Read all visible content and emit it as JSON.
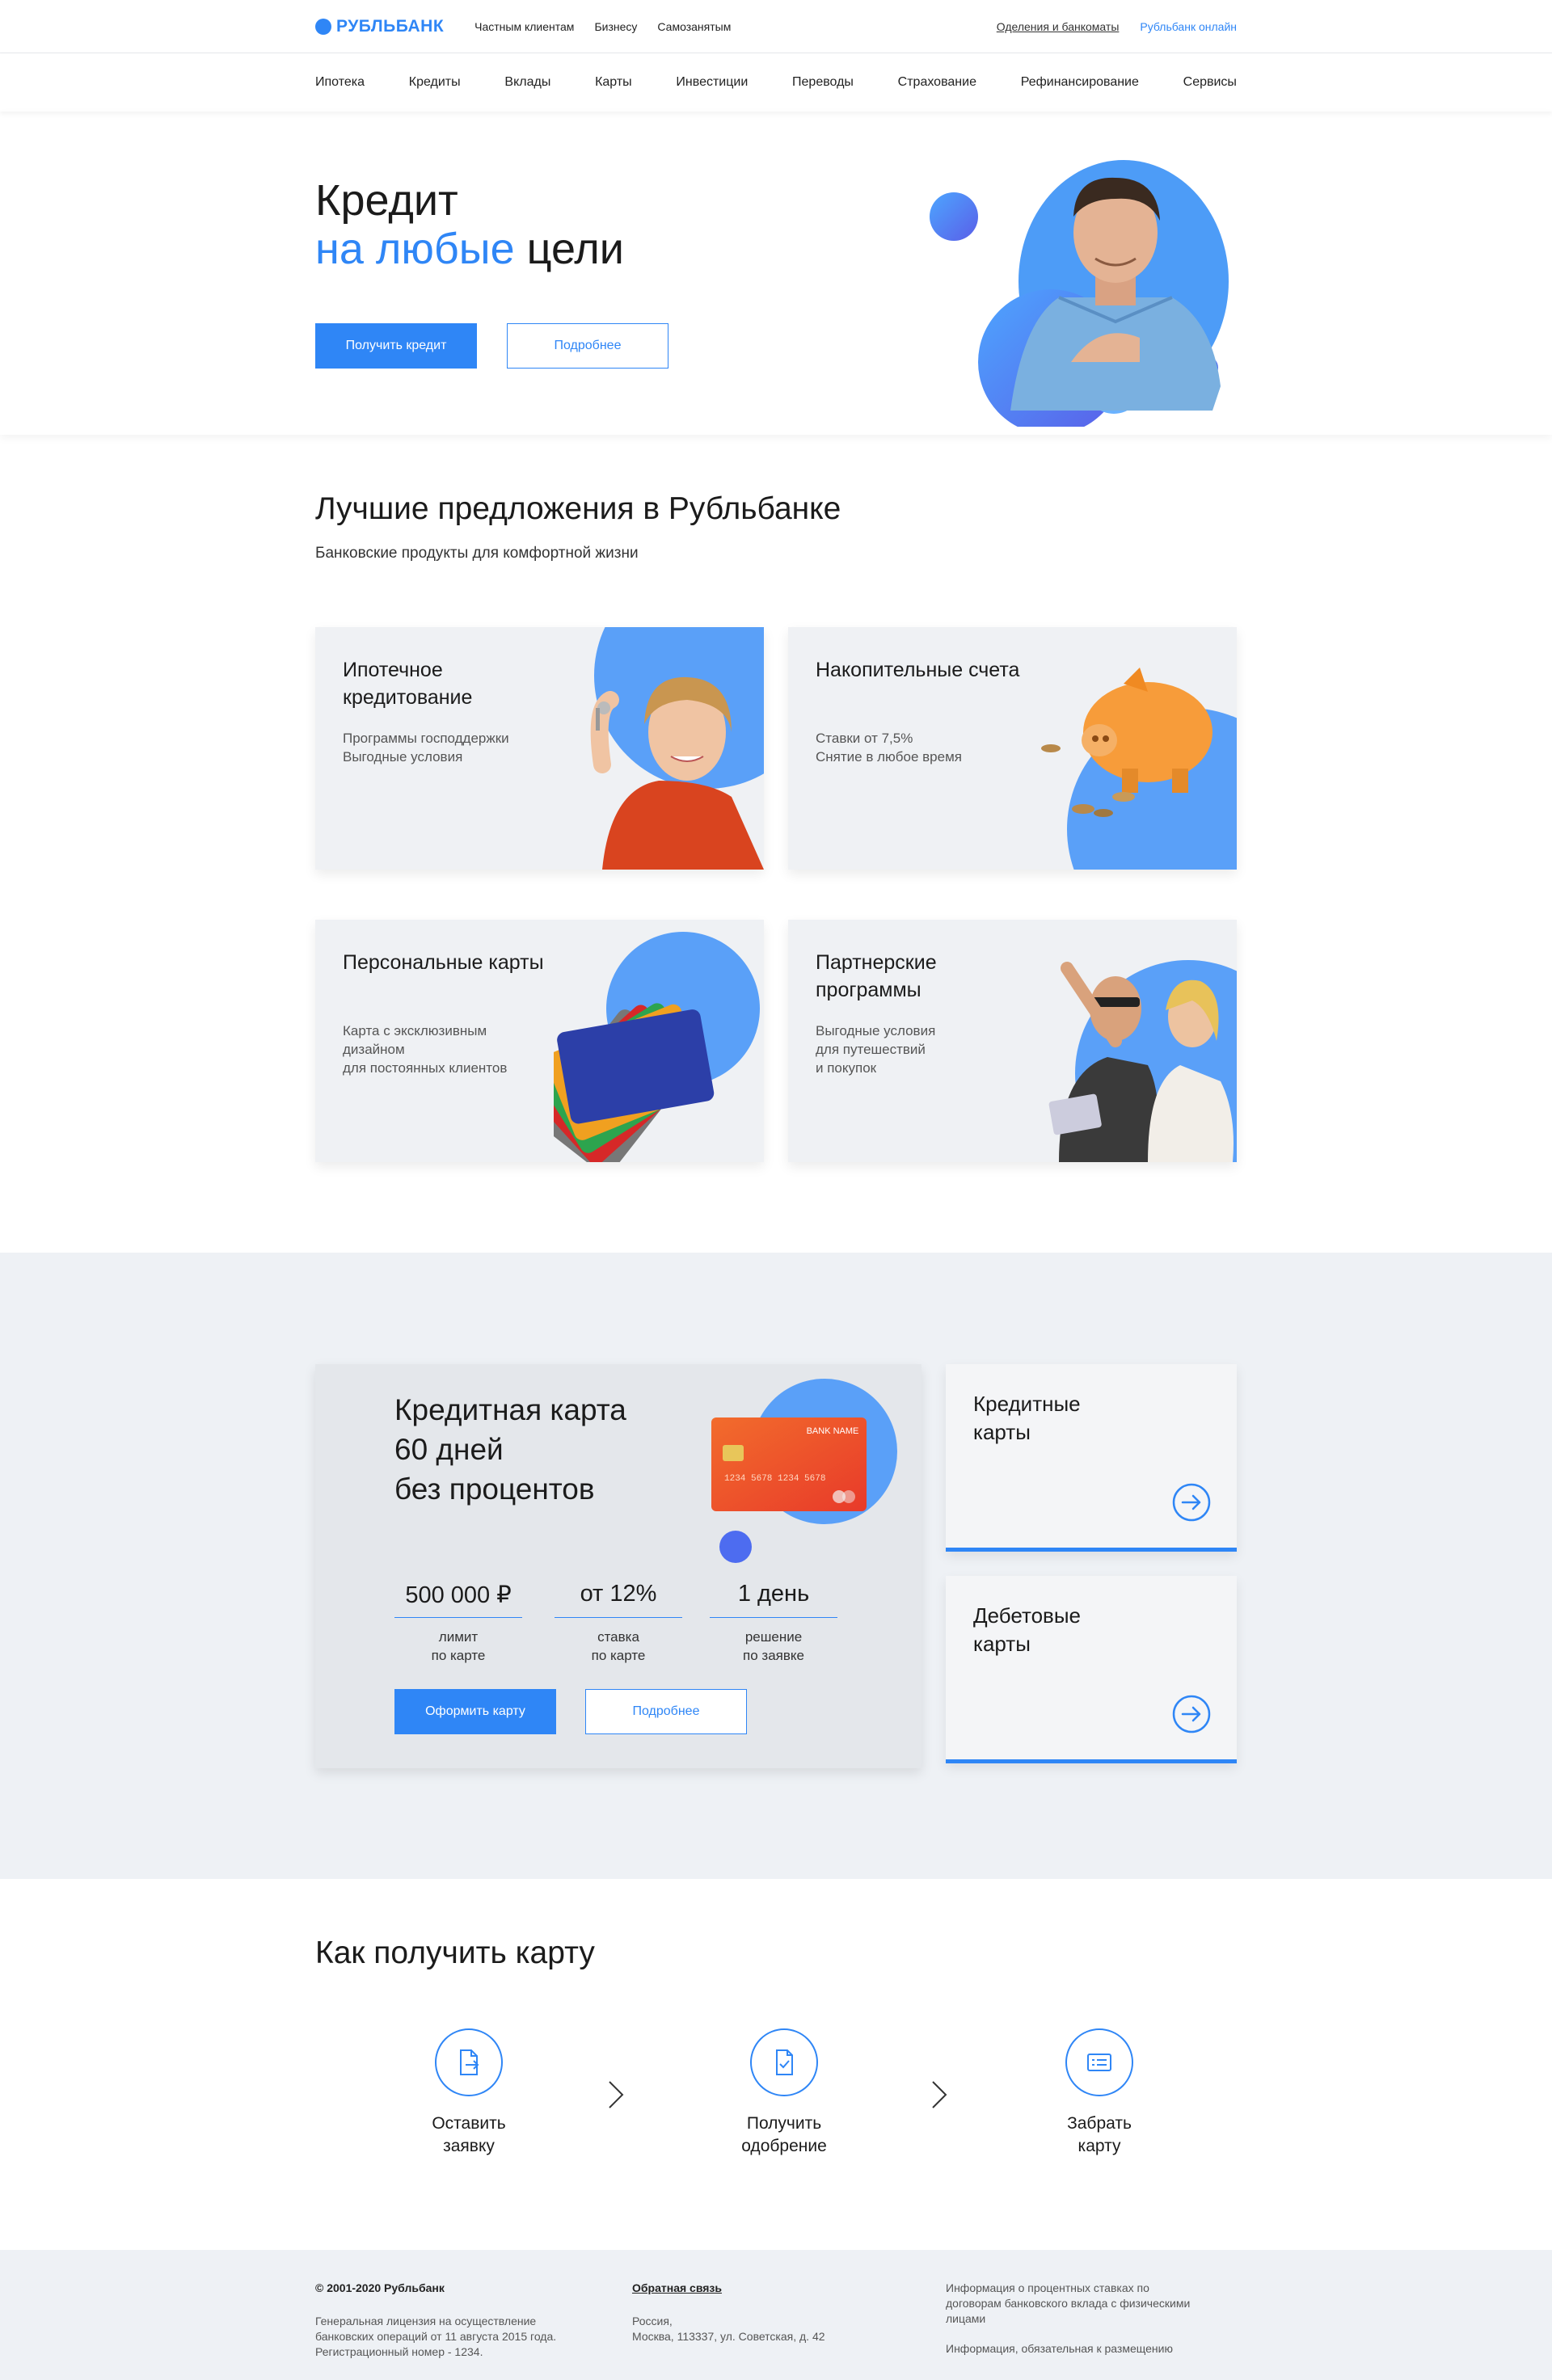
{
  "brand": {
    "name": "РУБЛЬБАНК",
    "accent": "#2f86f6"
  },
  "topbar": {
    "segments": [
      "Частным клиентам",
      "Бизнесу",
      "Самозанятым"
    ],
    "branches": "Оделения и банкоматы",
    "online": "Рубльбанк онлайн"
  },
  "nav": [
    "Ипотека",
    "Кредиты",
    "Вклады",
    "Карты",
    "Инвестиции",
    "Переводы",
    "Страхование",
    "Рефинансирование",
    "Сервисы"
  ],
  "hero": {
    "title_line1": "Кредит",
    "title_accent": "на любые",
    "title_rest": " цели",
    "primary": "Получить кредит",
    "secondary": "Подробнее"
  },
  "offers": {
    "title": "Лучшие предложения в Рубльбанке",
    "subtitle": "Банковские продукты для комфортной жизни",
    "cards": [
      {
        "title": "Ипотечное кредитование",
        "desc": "Программы господдержки\nВыгодные условия",
        "icon": "woman-with-keys-illustration"
      },
      {
        "title": "Накопительные счета",
        "desc": "Ставки от 7,5%\nСнятие в любое время",
        "icon": "piggy-bank-illustration"
      },
      {
        "title": "Персональные карты",
        "desc": "Карта с эксклюзивным\nдизайном\nдля постоянных клиентов",
        "icon": "cards-fan-illustration"
      },
      {
        "title": "Партнерские программы",
        "desc": "Выгодные условия\nдля путешествий\nи покупок",
        "icon": "travel-couple-illustration"
      }
    ]
  },
  "promo": {
    "title": "Кредитная карта\n60 дней\nбез процентов",
    "card_bank_name": "BANK NAME",
    "card_number": "1234  5678  1234  5678",
    "stats": [
      {
        "value": "500 000 ₽",
        "label": "лимит\nпо карте"
      },
      {
        "value": "от 12%",
        "label": "ставка\nпо карте"
      },
      {
        "value": "1 день",
        "label": "решение\nпо заявке"
      }
    ],
    "primary": "Оформить карту",
    "secondary": "Подробнее",
    "side_cards": [
      {
        "title": "Кредитные\nкарты"
      },
      {
        "title": "Дебетовые\nкарты"
      }
    ]
  },
  "steps": {
    "title": "Как получить карту",
    "items": [
      {
        "label": "Оставить\nзаявку",
        "icon": "document-send-icon"
      },
      {
        "label": "Получить\nодобрение",
        "icon": "document-check-icon"
      },
      {
        "label": "Забрать\nкарту",
        "icon": "card-icon"
      }
    ]
  },
  "footer": {
    "copyright": "© 2001-2020 Рубльбанк",
    "license": "Генеральная лицензия на осуществление\nбанковских операций от 11 августа 2015 года.\nРегистрационный номер - 1234.",
    "feedback": "Обратная связь",
    "address": "Россия,\nМосква, 113337, ул. Советская, д. 42",
    "rates_info": "Информация о процентных ставках по\nдоговорам банковского вклада с физическими\nлицами",
    "disclosure": "Информация, обязательная к размещению"
  }
}
